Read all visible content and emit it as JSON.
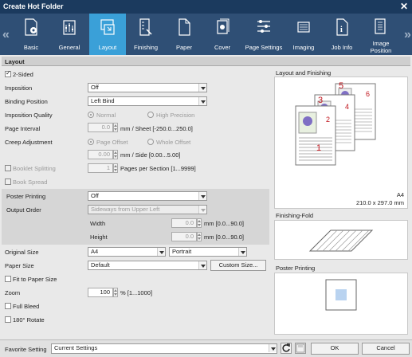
{
  "window": {
    "title": "Create Hot Folder"
  },
  "tabs": [
    {
      "label": "Basic",
      "icon": "basic-icon"
    },
    {
      "label": "General",
      "icon": "general-icon"
    },
    {
      "label": "Layout",
      "icon": "layout-icon",
      "active": true
    },
    {
      "label": "Finishing",
      "icon": "finishing-icon"
    },
    {
      "label": "Paper",
      "icon": "paper-icon"
    },
    {
      "label": "Cover",
      "icon": "cover-icon"
    },
    {
      "label": "Page Settings",
      "icon": "page-settings-icon"
    },
    {
      "label": "Imaging",
      "icon": "imaging-icon"
    },
    {
      "label": "Job Info",
      "icon": "job-info-icon"
    },
    {
      "label": "Image Position",
      "icon": "image-position-icon"
    }
  ],
  "section": {
    "title": "Layout"
  },
  "form": {
    "two_sided": {
      "label": "2-Sided",
      "checked": true
    },
    "imposition": {
      "label": "Imposition",
      "value": "Off"
    },
    "binding_position": {
      "label": "Binding Position",
      "value": "Left Bind"
    },
    "imposition_quality": {
      "label": "Imposition Quality",
      "normal": "Normal",
      "high": "High Precision"
    },
    "page_interval": {
      "label": "Page Interval",
      "value": "0.0",
      "unit": "mm / Sheet [-250.0...250.0]"
    },
    "creep_adjustment": {
      "label": "Creep Adjustment",
      "page_offset": "Page Offset",
      "whole_offset": "Whole Offset",
      "value": "0.00",
      "unit": "mm / Side [0.00...5.00]"
    },
    "booklet_splitting": {
      "label": "Booklet Splitting",
      "value": "1",
      "unit": "Pages per Section [1...9999]"
    },
    "book_spread": {
      "label": "Book Spread"
    },
    "poster_printing": {
      "label": "Poster Printing",
      "value": "Off"
    },
    "output_order": {
      "label": "Output Order",
      "value": "Sideways from Upper Left"
    },
    "width": {
      "label": "Width",
      "value": "0.0",
      "unit": "mm [0.0...90.0]"
    },
    "height": {
      "label": "Height",
      "value": "0.0",
      "unit": "mm [0.0...90.0]"
    },
    "original_size": {
      "label": "Original Size",
      "value": "A4",
      "orientation": "Portrait"
    },
    "paper_size": {
      "label": "Paper Size",
      "value": "Default",
      "custom_button": "Custom Size..."
    },
    "fit_to_paper": {
      "label": "Fit to Paper Size"
    },
    "zoom": {
      "label": "Zoom",
      "value": "100",
      "unit": "% [1...1000]"
    },
    "full_bleed": {
      "label": "Full Bleed"
    },
    "rotate": {
      "label": "180° Rotate"
    }
  },
  "right_panel": {
    "layout_title": "Layout and Finishing",
    "paper_name": "A4",
    "paper_dims": "210.0 x 297.0 mm",
    "page_numbers": [
      "1",
      "3",
      "5",
      "6",
      "4",
      "2"
    ],
    "finishing_title": "Finishing-Fold",
    "poster_title": "Poster Printing"
  },
  "footer": {
    "favorite_label": "Favorite Setting",
    "favorite_value": "Current Settings",
    "ok": "OK",
    "cancel": "Cancel"
  },
  "colors": {
    "titlebar": "#1b3a5e",
    "ribbon": "#2f4f75",
    "active_tab": "#3aa0d8",
    "page_number": "#c0141c"
  }
}
